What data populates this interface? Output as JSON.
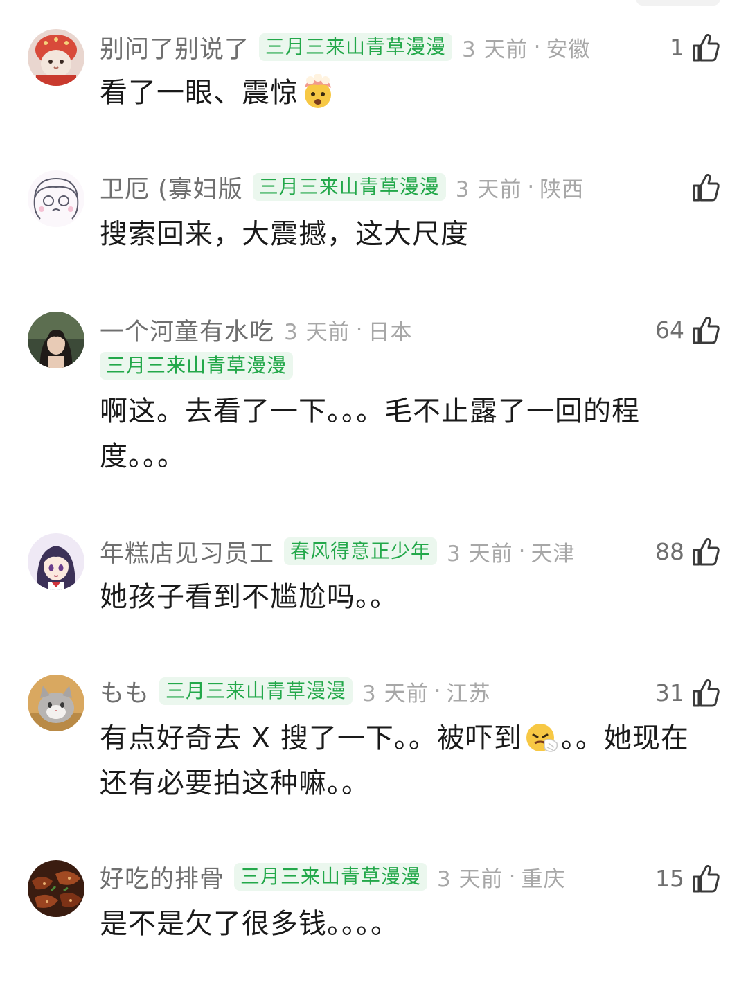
{
  "comments": [
    {
      "avatar": "cat-in-red-hood-avatar",
      "username": "别问了别说了",
      "badge": "三月三来山青草漫漫",
      "time": "3 天前",
      "location": "安徽",
      "likes": "1",
      "text_before": "看了一眼、震惊",
      "emoji": "exploding-head-emoji",
      "text_after": ""
    },
    {
      "avatar": "anime-sketch-girl-avatar",
      "username": "卫厄 (寡妇版",
      "badge": "三月三来山青草漫漫",
      "time": "3 天前",
      "location": "陕西",
      "likes": "",
      "text": "搜索回来，大震撼，这大尺度"
    },
    {
      "avatar": "woman-photo-avatar",
      "username": "一个河童有水吃",
      "badge": "三月三来山青草漫漫",
      "time": "3 天前",
      "location": "日本",
      "likes": "64",
      "text_line1": "啊这。去看了一下。。。毛不止露了一回的程",
      "text_line2": "度。。。"
    },
    {
      "avatar": "anime-girl-avatar",
      "username": "年糕店见习员工",
      "badge": "春风得意正少年",
      "time": "3 天前",
      "location": "天津",
      "likes": "88",
      "text": "她孩子看到不尴尬吗。。"
    },
    {
      "avatar": "grey-cat-avatar",
      "username": "もも",
      "badge": "三月三来山青草漫漫",
      "time": "3 天前",
      "location": "江苏",
      "likes": "31",
      "text_line1_before": "有点好奇去 X 搜了一下。。被吓到",
      "emoji": "sneezing-face-emoji",
      "text_line1_after": "。。她现在",
      "text_line2": "还有必要拍这种嘛。。"
    },
    {
      "avatar": "spare-ribs-food-avatar",
      "username": "好吃的排骨",
      "badge": "三月三来山青草漫漫",
      "time": "3 天前",
      "location": "重庆",
      "likes": "15",
      "text": "是不是欠了很多钱。。。。"
    }
  ],
  "separator": "·",
  "colors": {
    "badge_text": "#23a84a",
    "badge_bg": "#ebf7ee",
    "meta_text": "#a7a7a7",
    "username": "#6f6f6f"
  }
}
